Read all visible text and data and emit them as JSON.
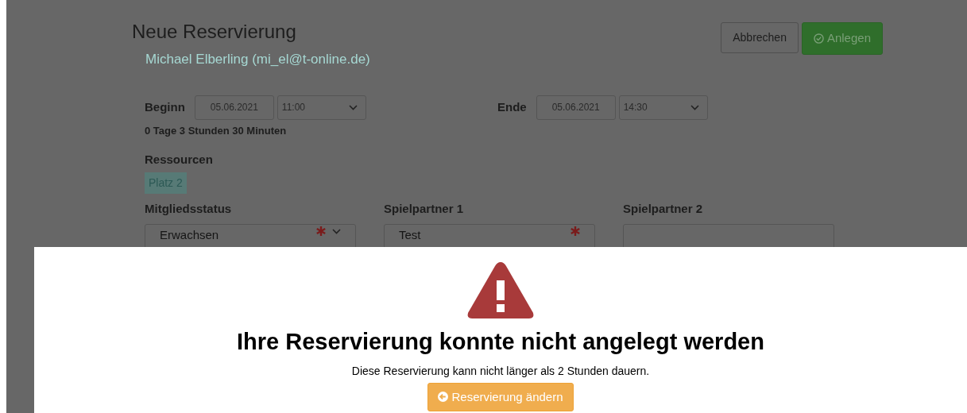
{
  "form": {
    "title": "Neue Reservierung",
    "user": "Michael Elberling (mi_el@t-online.de)",
    "buttons": [
      {
        "label": "Abbrechen",
        "kind": "default"
      },
      {
        "label": "Anlegen",
        "kind": "primary"
      }
    ],
    "begin": {
      "label": "Beginn",
      "date": "05.06.2021",
      "time": "11:00"
    },
    "end": {
      "label": "Ende",
      "date": "05.06.2021",
      "time": "14:30"
    },
    "duration": "0 Tage 3 Stunden 30 Minuten",
    "resources": {
      "label": "Ressourcen",
      "items": [
        "Platz 2"
      ]
    },
    "fields": [
      {
        "label": "Mitgliedsstatus",
        "value": "Erwachsen",
        "required": true,
        "kind": "select"
      },
      {
        "label": "Spielpartner 1",
        "value": "Test",
        "required": true,
        "kind": "text"
      },
      {
        "label": "Spielpartner 2",
        "required": false,
        "kind": "text"
      }
    ]
  },
  "dialog": {
    "title": "Ihre Reservierung konnte nicht angelegt werden",
    "message": "Diese Reservierung kann nicht länger als 2 Stunden dauern.",
    "button": "Reservierung ändern"
  }
}
